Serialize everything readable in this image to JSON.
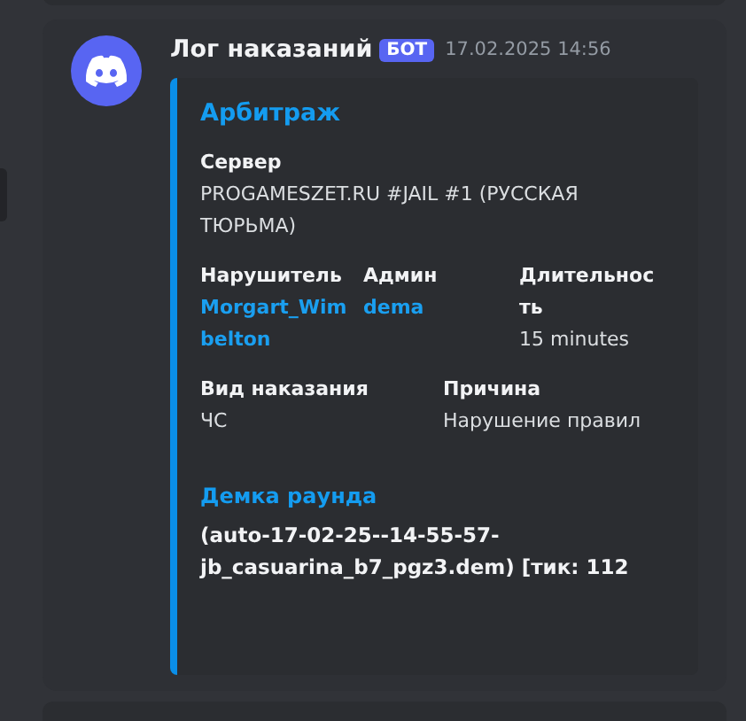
{
  "message": {
    "author": "Лог наказаний",
    "badge": "БОТ",
    "timestamp": "17.02.2025 14:56"
  },
  "embed": {
    "title": "Арбитраж",
    "fields": [
      {
        "name": "Сервер",
        "value": "PROGAMESZET.RU #JAIL #1 (РУССКАЯ ТЮРЬМА)",
        "kind": "text",
        "inline": false
      },
      {
        "name": "Нарушитель",
        "value": "Morgart_Wimbelton",
        "kind": "link",
        "inline": true
      },
      {
        "name": "Админ",
        "value": "dema",
        "kind": "link",
        "inline": true
      },
      {
        "name": "Длительность",
        "value": "15 minutes",
        "kind": "text",
        "inline": true
      },
      {
        "name": "Вид наказания",
        "value": "ЧС",
        "kind": "text",
        "inline": true
      },
      {
        "name": "Причина",
        "value": "Нарушение правил",
        "kind": "text",
        "inline": true
      },
      {
        "name": "Демка раунда",
        "value": "(auto-17-02-25--14-55-57-jb_casuarina_b7_pgz3.dem) [тик: 112",
        "kind": "heading",
        "inline": false
      }
    ]
  }
}
